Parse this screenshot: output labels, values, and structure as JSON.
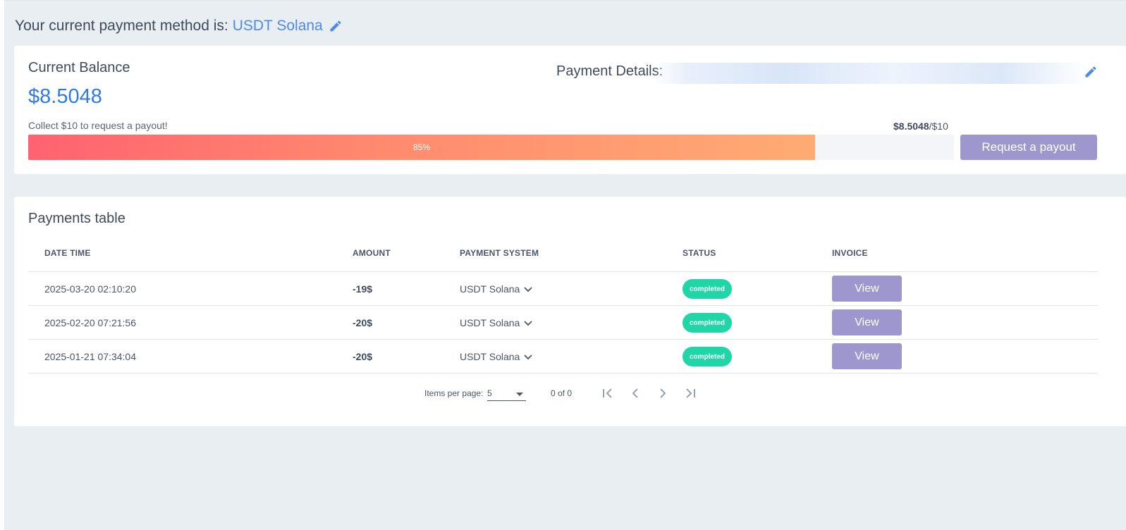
{
  "header": {
    "method_prefix": "Your current payment method is:",
    "method_value": "USDT Solana",
    "edit_icon": "pencil-icon"
  },
  "balance": {
    "title": "Current Balance",
    "amount": "$8.5048",
    "hint": "Collect $10 to request a payout!",
    "payment_details_label": "Payment Details:",
    "goal_current": "$8.5048",
    "goal_target": "/$10",
    "progress_percent": 85,
    "progress_label": "85%",
    "payout_button": "Request a payout",
    "colors": {
      "accent": "#2f7be3",
      "button": "#9d97ce",
      "progress_start": "#ff6270",
      "progress_end": "#ffab73"
    }
  },
  "payments": {
    "title": "Payments table",
    "columns": {
      "date": "DATE TIME",
      "amount": "AMOUNT",
      "system": "PAYMENT SYSTEM",
      "status": "STATUS",
      "invoice": "INVOICE"
    },
    "rows": [
      {
        "date": "2025-03-20 02:10:20",
        "amount": "-19$",
        "system": "USDT Solana",
        "status": "completed",
        "invoice": "View"
      },
      {
        "date": "2025-02-20 07:21:56",
        "amount": "-20$",
        "system": "USDT Solana",
        "status": "completed",
        "invoice": "View"
      },
      {
        "date": "2025-01-21 07:34:04",
        "amount": "-20$",
        "system": "USDT Solana",
        "status": "completed",
        "invoice": "View"
      }
    ],
    "paginator": {
      "items_label": "Items per page:",
      "items_value": "5",
      "range": "0 of 0",
      "icons": [
        "first-page-icon",
        "previous-page-icon",
        "next-page-icon",
        "last-page-icon"
      ]
    },
    "status_color": "#1fd6a7"
  }
}
